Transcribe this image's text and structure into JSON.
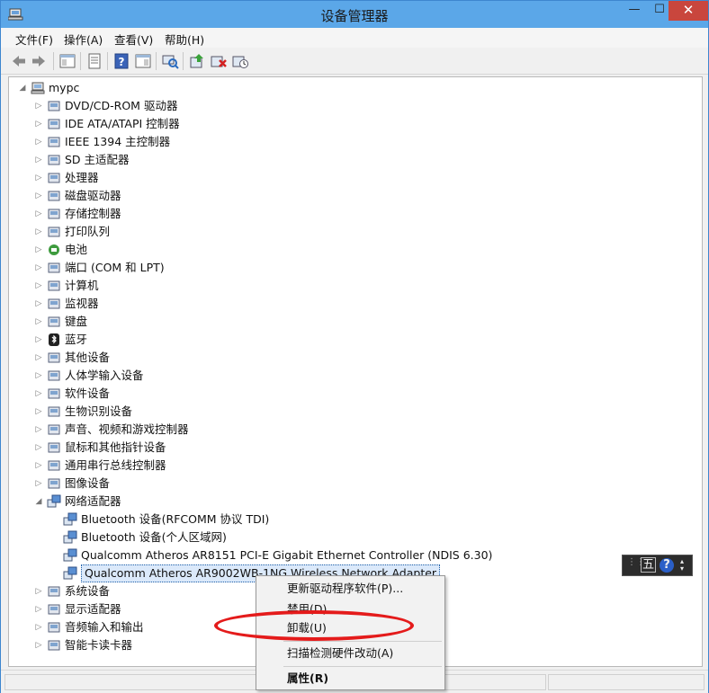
{
  "window": {
    "title": "设备管理器",
    "controls": {
      "minimize": "—",
      "maximize": "☐",
      "close": "✕"
    }
  },
  "menubar": [
    {
      "label": "文件(F)"
    },
    {
      "label": "操作(A)"
    },
    {
      "label": "查看(V)"
    },
    {
      "label": "帮助(H)"
    }
  ],
  "toolbar": [
    "back-icon",
    "forward-icon",
    "show-hide-console-tree-icon",
    "properties-icon",
    "help-icon",
    "action-pane-icon",
    "scan-hardware-icon",
    "update-driver-icon",
    "uninstall-icon",
    "disable-icon"
  ],
  "tree": {
    "root": {
      "label": "mypc",
      "expanded": true
    },
    "categories": [
      {
        "label": "DVD/CD-ROM 驱动器",
        "icon": "dvd-icon"
      },
      {
        "label": "IDE ATA/ATAPI 控制器",
        "icon": "ide-controller-icon"
      },
      {
        "label": "IEEE 1394 主控制器",
        "icon": "ieee1394-icon"
      },
      {
        "label": "SD 主适配器",
        "icon": "sd-card-icon"
      },
      {
        "label": "处理器",
        "icon": "processor-icon"
      },
      {
        "label": "磁盘驱动器",
        "icon": "disk-drive-icon"
      },
      {
        "label": "存储控制器",
        "icon": "storage-controller-icon"
      },
      {
        "label": "打印队列",
        "icon": "printer-icon"
      },
      {
        "label": "电池",
        "icon": "battery-icon"
      },
      {
        "label": "端口 (COM 和 LPT)",
        "icon": "port-icon"
      },
      {
        "label": "计算机",
        "icon": "computer-icon"
      },
      {
        "label": "监视器",
        "icon": "monitor-icon"
      },
      {
        "label": "键盘",
        "icon": "keyboard-icon"
      },
      {
        "label": "蓝牙",
        "icon": "bluetooth-icon"
      },
      {
        "label": "其他设备",
        "icon": "other-devices-icon"
      },
      {
        "label": "人体学输入设备",
        "icon": "hid-icon"
      },
      {
        "label": "软件设备",
        "icon": "software-device-icon"
      },
      {
        "label": "生物识别设备",
        "icon": "biometric-icon"
      },
      {
        "label": "声音、视频和游戏控制器",
        "icon": "sound-icon"
      },
      {
        "label": "鼠标和其他指针设备",
        "icon": "mouse-icon"
      },
      {
        "label": "通用串行总线控制器",
        "icon": "usb-icon"
      },
      {
        "label": "图像设备",
        "icon": "imaging-icon"
      },
      {
        "label": "网络适配器",
        "icon": "network-adapter-icon",
        "expanded": true,
        "children": [
          {
            "label": "Bluetooth 设备(RFCOMM 协议 TDI)"
          },
          {
            "label": "Bluetooth 设备(个人区域网)"
          },
          {
            "label": "Qualcomm Atheros AR8151 PCI-E Gigabit Ethernet Controller (NDIS 6.30)"
          },
          {
            "label": "Qualcomm Atheros AR9002WB-1NG Wireless Network Adapter",
            "selected": true
          }
        ]
      },
      {
        "label": "系统设备",
        "icon": "system-devices-icon"
      },
      {
        "label": "显示适配器",
        "icon": "display-adapter-icon"
      },
      {
        "label": "音频输入和输出",
        "icon": "audio-io-icon"
      },
      {
        "label": "智能卡读卡器",
        "icon": "smartcard-reader-icon"
      }
    ]
  },
  "context_menu": {
    "items": [
      {
        "label": "更新驱动程序软件(P)..."
      },
      {
        "label": "禁用(D)"
      },
      {
        "label": "卸载(U)",
        "highlighted_by_annotation": true
      },
      {
        "label": "扫描检测硬件改动(A)"
      },
      {
        "label": "属性(R)",
        "bold": true
      }
    ]
  },
  "ime_bar": {
    "mode": "五",
    "help": "?"
  },
  "colors": {
    "titlebar": "#5ba7e8",
    "close": "#c9463d",
    "annotation": "#e41b1b",
    "selection": "#dbe9fa"
  }
}
